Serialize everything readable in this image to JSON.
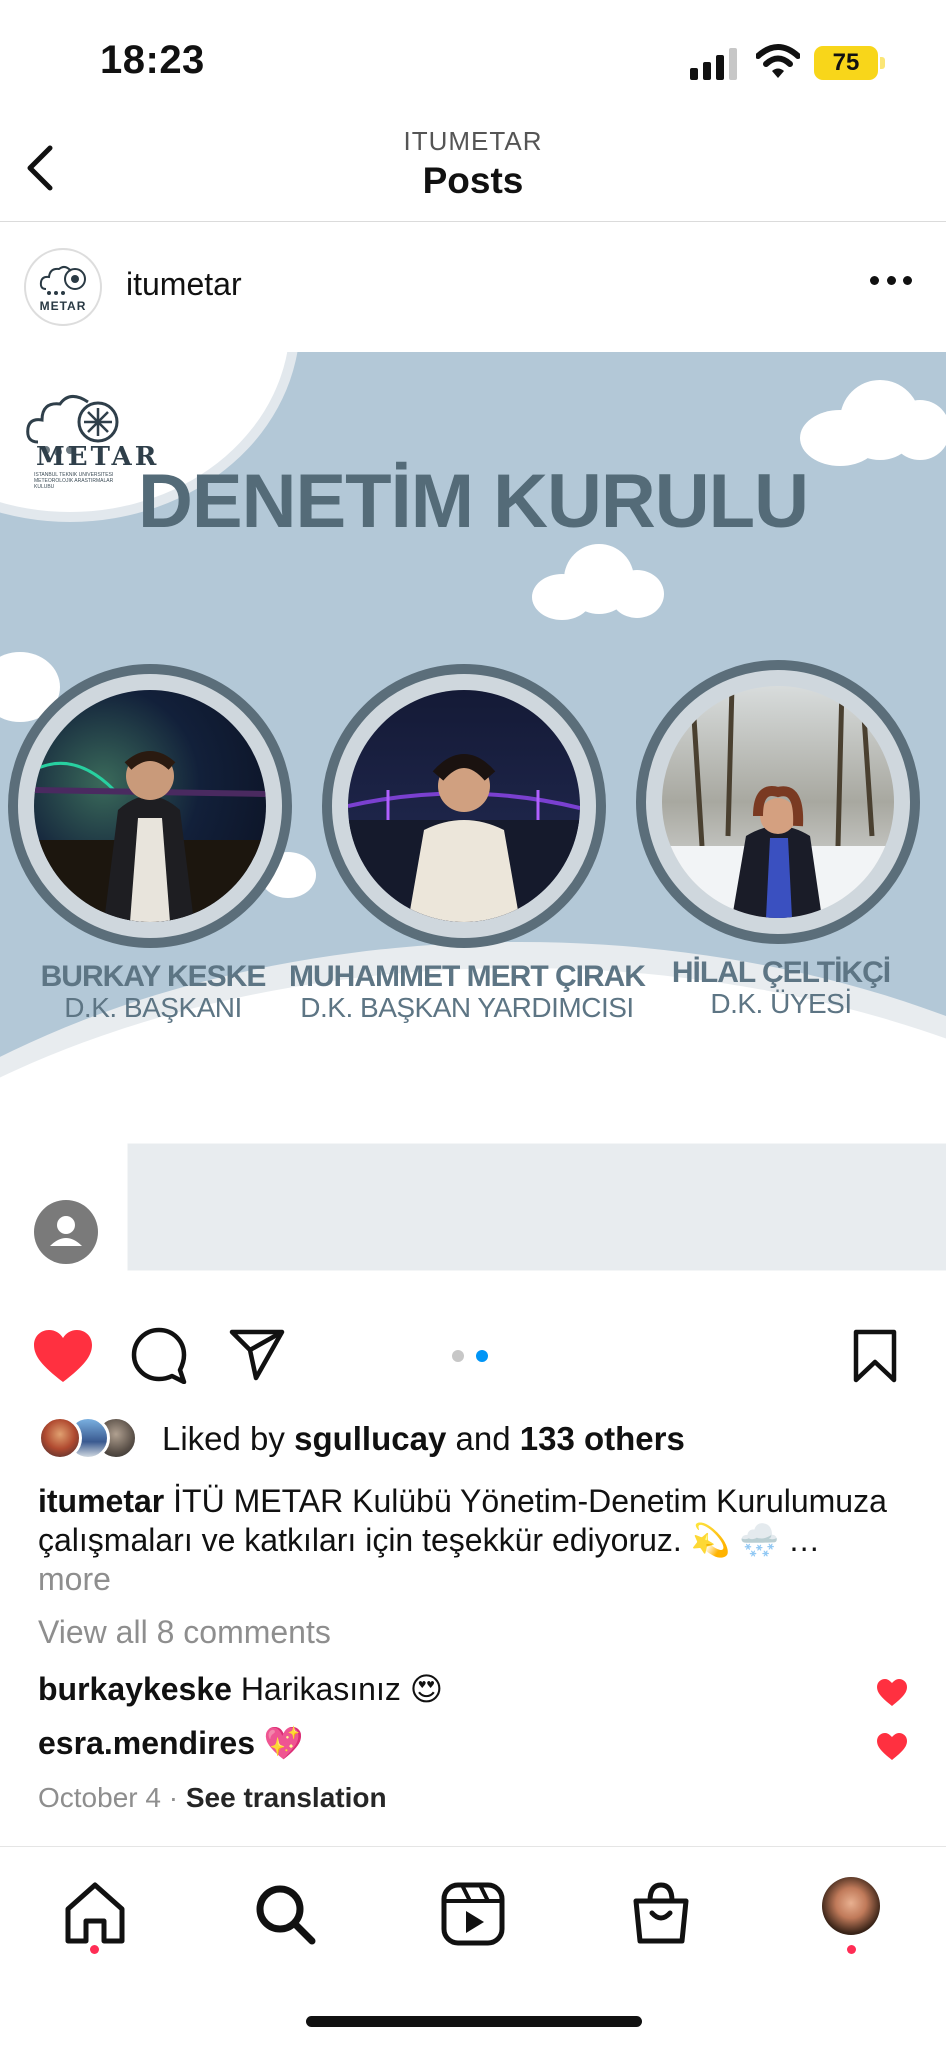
{
  "status_bar": {
    "time": "18:23",
    "battery": "75"
  },
  "header": {
    "account": "ITUMETAR",
    "title": "Posts"
  },
  "post": {
    "username": "itumetar",
    "image": {
      "logo_text": "METAR",
      "logo_subtext": "ISTANBUL TEKNIK UNIVERSITESI METEOROLOJIK ARASTIRMALAR KULUBU",
      "title": "DENETİM KURULU",
      "members": [
        {
          "name": "BURKAY KESKE",
          "role": "D.K. BAŞKANI"
        },
        {
          "name": "MUHAMMET MERT ÇIRAK",
          "role": "D.K. BAŞKAN YARDIMCISI"
        },
        {
          "name": "HİLAL ÇELTİKÇİ",
          "role": "D.K. ÜYESİ"
        }
      ]
    },
    "carousel": {
      "total": 2,
      "active_index": 2
    },
    "likes": {
      "prefix": "Liked by",
      "user": "sgullucay",
      "middle": "and",
      "others": "133 others"
    },
    "caption": {
      "username": "itumetar",
      "text": "İTÜ METAR Kulübü Yönetim-Denetim Kurulumuza çalışmaları ve katkıları için teşekkür ediyoruz. 💫 🌨️ …",
      "more": "more"
    },
    "view_comments": "View all 8 comments",
    "comments": [
      {
        "username": "burkaykeske",
        "text": "Harikasınız 😍"
      },
      {
        "username": "esra.mendires",
        "text": "💖"
      }
    ],
    "date": "October 4",
    "separator": "·",
    "translate": "See translation"
  },
  "colors": {
    "like": "#ff3040",
    "active_dot": "#0095f6",
    "title": "#546b78",
    "background": "#b3c8d7"
  }
}
